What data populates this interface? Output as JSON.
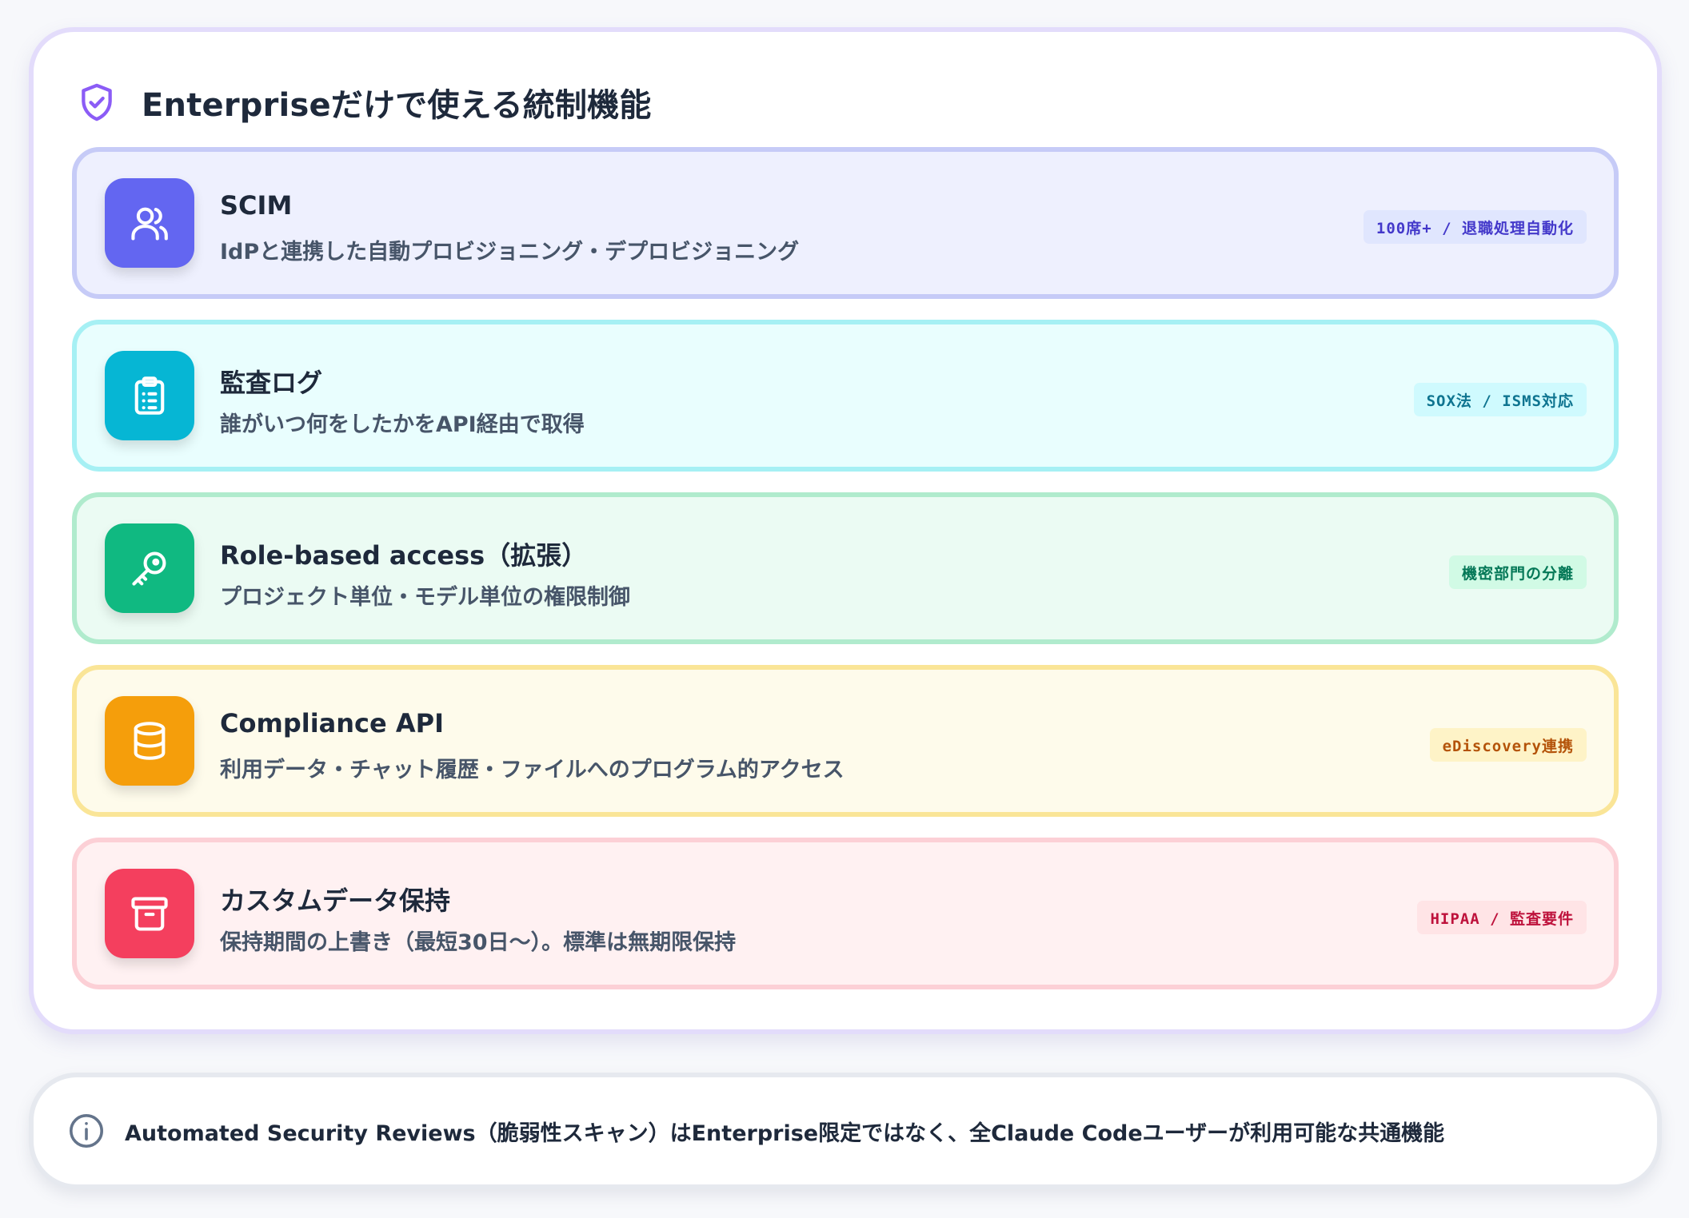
{
  "header": {
    "title": "Enterpriseだけで使える統制機能",
    "icon": "shield-check-icon",
    "accent_color": "#8b5cf6"
  },
  "features": [
    {
      "title": "SCIM",
      "description": "IdPと連携した自動プロビジョニング・デプロビジョニング",
      "tag": "100席+ / 退職処理自動化",
      "icon": "users-icon",
      "icon_bg": "#6366f1",
      "tag_bg": "#e0e6fe",
      "tag_color": "#4338ca"
    },
    {
      "title": "監査ログ",
      "description": "誰がいつ何をしたかをAPI経由で取得",
      "tag": "SOX法 / ISMS対応",
      "icon": "clipboard-list-icon",
      "icon_bg": "#06b6d4",
      "tag_bg": "#cffafe",
      "tag_color": "#0e7490"
    },
    {
      "title": "Role-based access（拡張）",
      "description": "プロジェクト単位・モデル単位の権限制御",
      "tag": "機密部門の分離",
      "icon": "key-icon",
      "icon_bg": "#10b981",
      "tag_bg": "#d1fae5",
      "tag_color": "#047857"
    },
    {
      "title": "Compliance API",
      "description": "利用データ・チャット履歴・ファイルへのプログラム的アクセス",
      "tag": "eDiscovery連携",
      "icon": "database-icon",
      "icon_bg": "#f59e0b",
      "tag_bg": "#fef3c7",
      "tag_color": "#b45309"
    },
    {
      "title": "カスタムデータ保持",
      "description": "保持期間の上書き（最短30日〜）。標準は無期限保持",
      "tag": "HIPAA / 監査要件",
      "icon": "archive-icon",
      "icon_bg": "#f43f5e",
      "tag_bg": "#ffe4e6",
      "tag_color": "#be123c"
    }
  ],
  "note": {
    "text": "Automated Security Reviews（脆弱性スキャン）はEnterprise限定ではなく、全Claude Codeユーザーが利用可能な共通機能",
    "icon": "info-circle-icon"
  }
}
